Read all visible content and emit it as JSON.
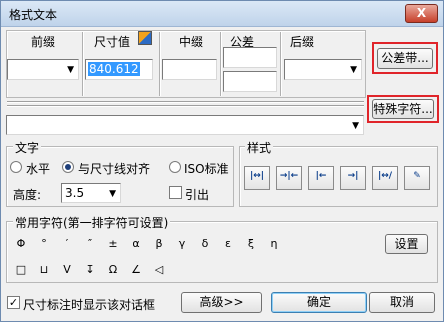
{
  "window": {
    "title": "格式文本",
    "close_label": "X"
  },
  "headers": {
    "prefix": "前缀",
    "dimension": "尺寸值",
    "middle": "中缀",
    "tolerance": "公差",
    "suffix": "后缀"
  },
  "fields": {
    "dimension_value": "840.612"
  },
  "buttons": {
    "tolerance_band": "公差带...",
    "special_char": "特殊字符...",
    "settings": "设置",
    "advanced": "高级>>",
    "ok": "确定",
    "cancel": "取消"
  },
  "text_group": {
    "title": "文字",
    "opt_horizontal": "水平",
    "opt_align": "与尺寸线对齐",
    "opt_iso": "ISO标准",
    "height_label": "高度:",
    "height_value": "3.5",
    "leader_label": "引出",
    "selected_option": "与尺寸线对齐"
  },
  "style_group": {
    "title": "样式",
    "icons": [
      "arrow-both-icon",
      "arrow-inside-icon",
      "arrow-out-left-icon",
      "arrow-out-right-icon",
      "arrow-slash-icon",
      "edit-style-icon"
    ]
  },
  "chars_group": {
    "title": "常用字符(第一排字符可设置)",
    "row1": [
      "Φ",
      "°",
      "′",
      "″",
      "±",
      "α",
      "β",
      "γ",
      "δ",
      "ε",
      "ξ",
      "η"
    ],
    "row2": [
      "□",
      "⊔",
      "V",
      "↧",
      "Ω",
      "∠",
      "◁"
    ]
  },
  "footer": {
    "show_dialog_label": "尺寸标注时显示该对话框",
    "show_dialog_checked": true
  }
}
